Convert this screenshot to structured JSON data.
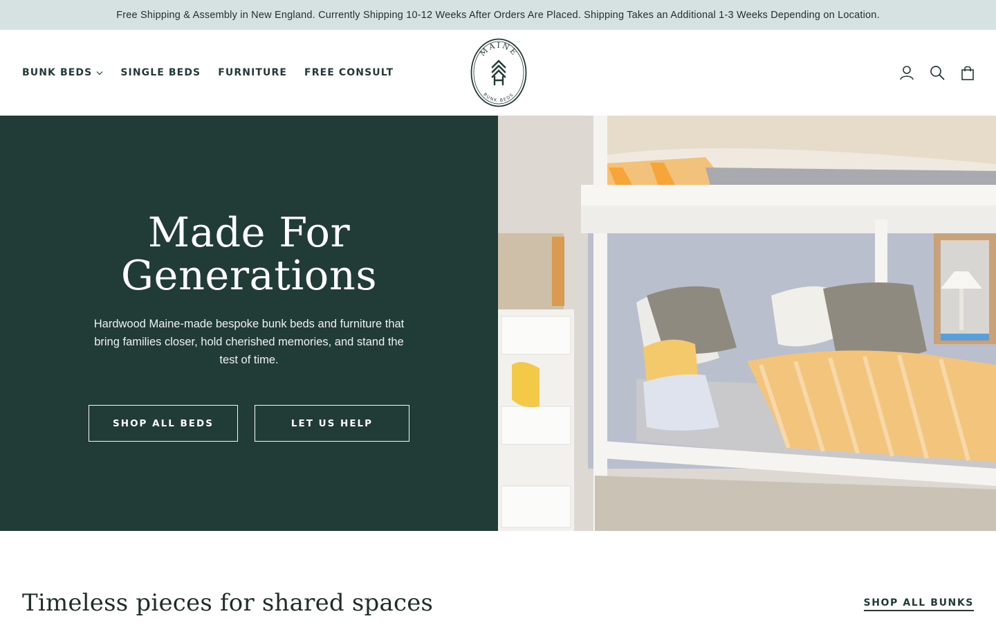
{
  "announcement": "Free Shipping & Assembly in New England. Currently Shipping 10-12 Weeks After Orders Are Placed. Shipping Takes an Additional 1-3 Weeks Depending on Location.",
  "nav": {
    "items": [
      {
        "label": "BUNK BEDS",
        "has_dropdown": true
      },
      {
        "label": "SINGLE BEDS"
      },
      {
        "label": "FURNITURE"
      },
      {
        "label": "FREE CONSULT"
      }
    ]
  },
  "logo": {
    "top_text": "MAINE",
    "bottom_text": "BUNK BEDS"
  },
  "header_icons": [
    "account-icon",
    "search-icon",
    "cart-icon"
  ],
  "hero": {
    "title": "Made For\nGenerations",
    "subtitle": "Hardwood Maine-made bespoke bunk beds and furniture that bring families closer, hold cherished memories, and stand the test of time.",
    "primary_button": "SHOP ALL BEDS",
    "secondary_button": "LET US HELP"
  },
  "section": {
    "title": "Timeless pieces for shared spaces",
    "link": "SHOP ALL BUNKS"
  },
  "colors": {
    "announcement_bg": "#d6e2e2",
    "brand_green": "#213b37",
    "text_dark": "#1f3a36"
  }
}
